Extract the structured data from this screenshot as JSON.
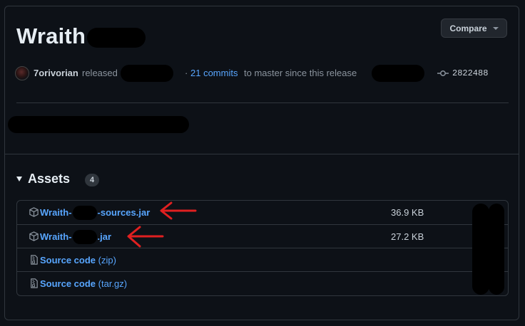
{
  "release": {
    "title": "Wraith",
    "author": "7orivorian",
    "released_text": "released",
    "separator": "·",
    "commits_link": "21 commits",
    "commits_suffix": "to master since this release",
    "commit_sha": "2822488"
  },
  "compare_button": {
    "label": "Compare"
  },
  "assets": {
    "heading": "Assets",
    "count": "4",
    "items": [
      {
        "name_prefix": "Wraith-",
        "name_suffix": "-sources.jar",
        "size": "36.9 KB",
        "icon": "package-icon"
      },
      {
        "name_prefix": "Wraith-",
        "name_suffix": ".jar",
        "size": "27.2 KB",
        "icon": "package-icon"
      },
      {
        "name": "Source code",
        "suffix": "(zip)",
        "icon": "file-zip-icon"
      },
      {
        "name": "Source code",
        "suffix": "(tar.gz)",
        "icon": "file-zip-icon"
      }
    ]
  },
  "colors": {
    "background": "#0d1117",
    "link": "#58a6ff",
    "border": "#30363d",
    "annotation_arrow": "#e02020"
  }
}
